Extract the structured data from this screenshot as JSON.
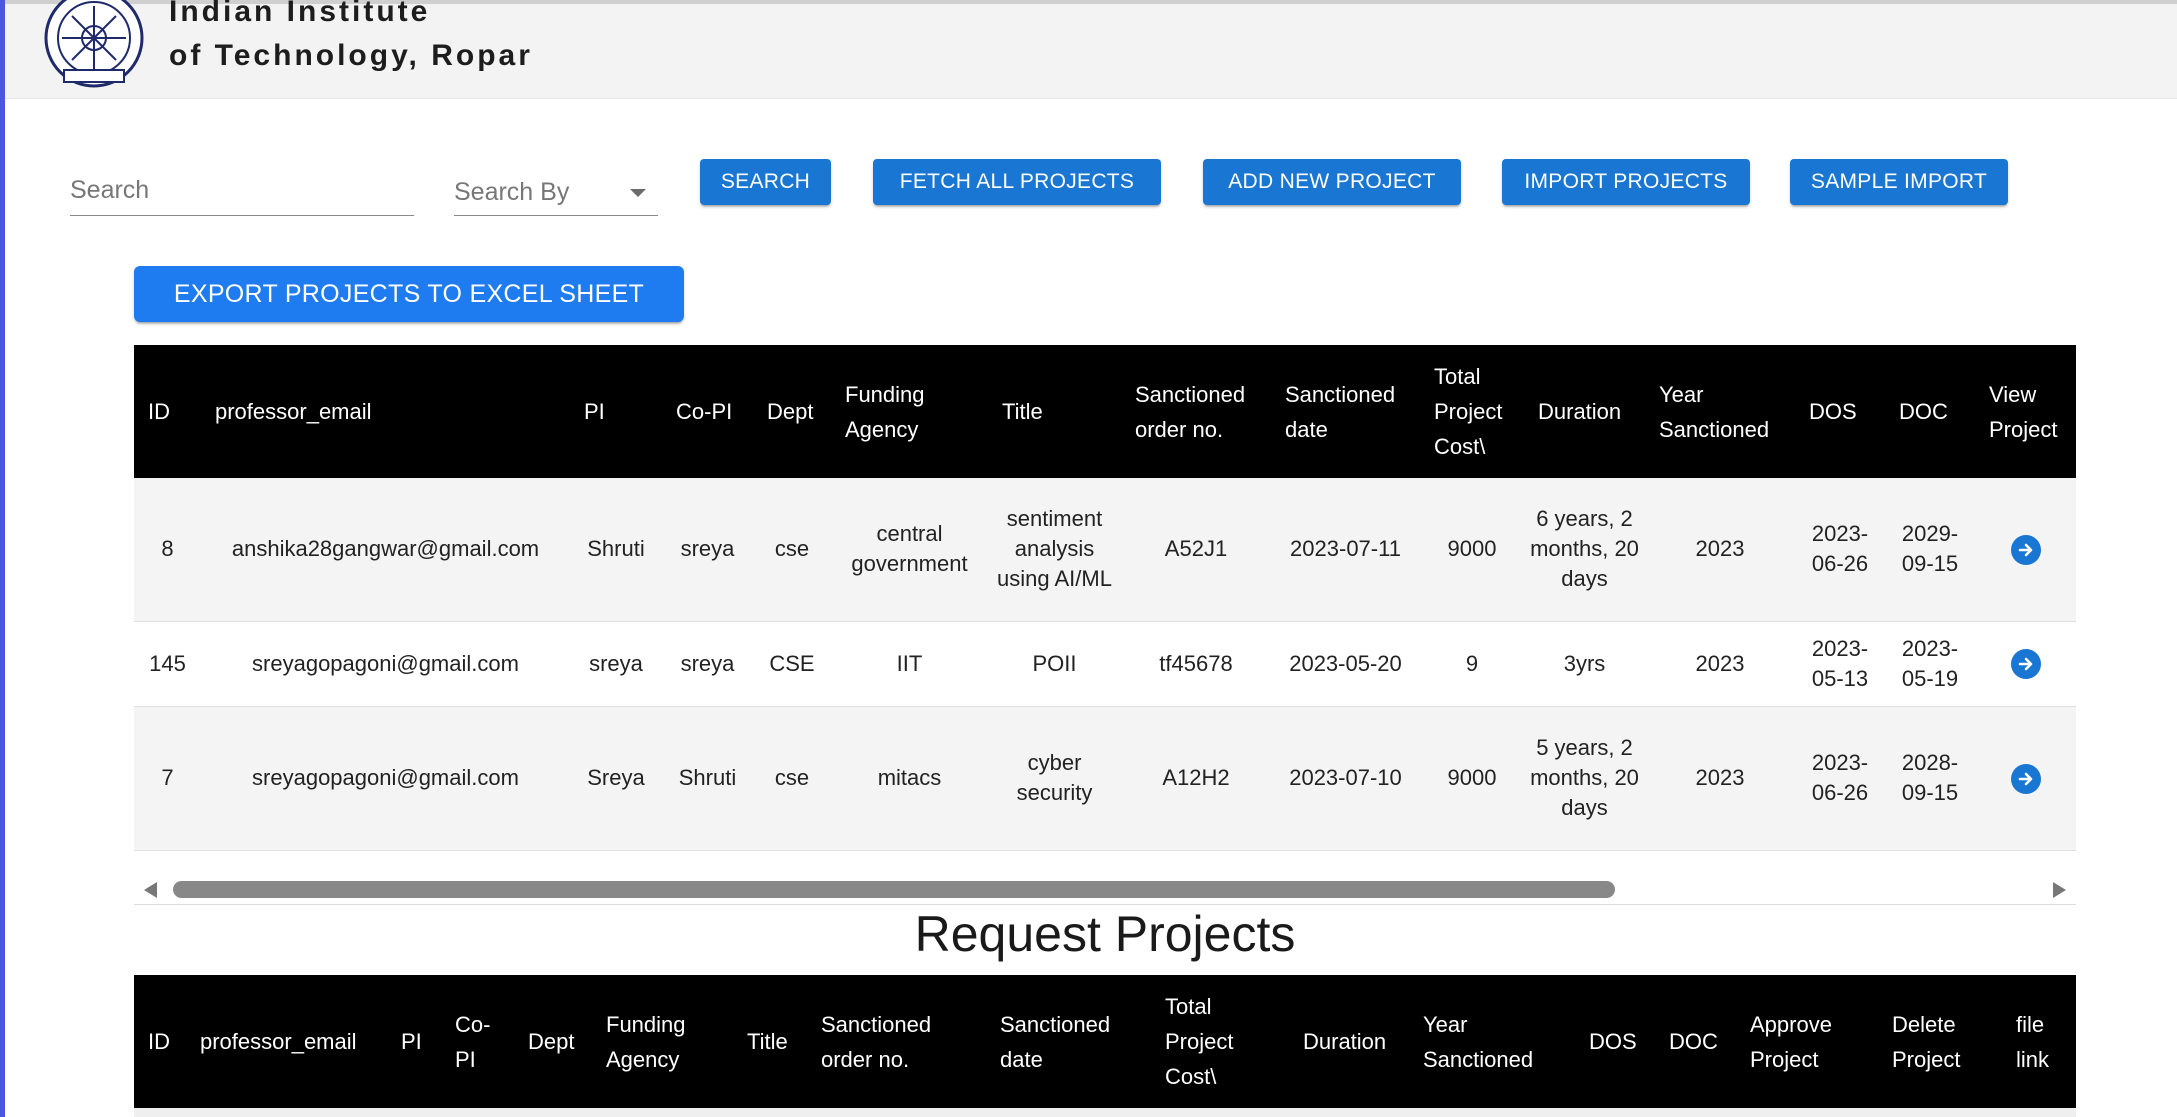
{
  "header": {
    "institute_line1": "Indian Institute",
    "institute_line2": "of Technology, Ropar",
    "logo_icon": "iit-ropar-seal-icon"
  },
  "search": {
    "placeholder": "Search",
    "search_by_label": "Search By"
  },
  "toolbar": {
    "search_label": "SEARCH",
    "fetch_all_label": "FETCH ALL PROJECTS",
    "add_new_label": "ADD NEW PROJECT",
    "import_label": "IMPORT PROJECTS",
    "sample_import_label": "SAMPLE IMPORT",
    "export_label": "EXPORT PROJECTS TO EXCEL SHEET"
  },
  "projects_table": {
    "columns": [
      "ID",
      "professor_email",
      "PI",
      "Co-PI",
      "Dept",
      "Funding Agency",
      "Title",
      "Sanctioned order no.",
      "Sanctioned date",
      "Total Project Cost\\",
      "Duration",
      "Year Sanctioned",
      "DOS",
      "DOC",
      "View Project"
    ],
    "rows": [
      {
        "id": "8",
        "professor_email": "anshika28gangwar@gmail.com",
        "pi": "Shruti",
        "co_pi": "sreya",
        "dept": "cse",
        "funding_agency": "central government",
        "title": "sentiment analysis using AI/ML",
        "order_no": "A52J1",
        "sanctioned_date": "2023-07-11",
        "cost": "9000",
        "duration": "6 years, 2 months, 20 days",
        "year": "2023",
        "dos": "2023-06-26",
        "doc": "2029-09-15"
      },
      {
        "id": "145",
        "professor_email": "sreyagopagoni@gmail.com",
        "pi": "sreya",
        "co_pi": "sreya",
        "dept": "CSE",
        "funding_agency": "IIT",
        "title": "POII",
        "order_no": "tf45678",
        "sanctioned_date": "2023-05-20",
        "cost": "9",
        "duration": "3yrs",
        "year": "2023",
        "dos": "2023-05-13",
        "doc": "2023-05-19"
      },
      {
        "id": "7",
        "professor_email": "sreyagopagoni@gmail.com",
        "pi": "Sreya",
        "co_pi": "Shruti",
        "dept": "cse",
        "funding_agency": "mitacs",
        "title": "cyber security",
        "order_no": "A12H2",
        "sanctioned_date": "2023-07-10",
        "cost": "9000",
        "duration": "5 years, 2 months, 20 days",
        "year": "2023",
        "dos": "2023-06-26",
        "doc": "2028-09-15"
      }
    ],
    "view_icon": "arrow-right-circle-icon"
  },
  "request_section": {
    "title": "Request Projects",
    "columns": [
      "ID",
      "professor_email",
      "PI",
      "Co-PI",
      "Dept",
      "Funding Agency",
      "Title",
      "Sanctioned order no.",
      "Sanctioned date",
      "Total Project Cost\\",
      "Duration",
      "Year Sanctioned",
      "DOS",
      "DOC",
      "Approve Project",
      "Delete Project",
      "file link"
    ]
  },
  "colors": {
    "primary_button": "#1976d2",
    "export_button": "#1e7bf0",
    "table_header_bg": "#000000",
    "left_edge_accent": "#4b57e0"
  }
}
